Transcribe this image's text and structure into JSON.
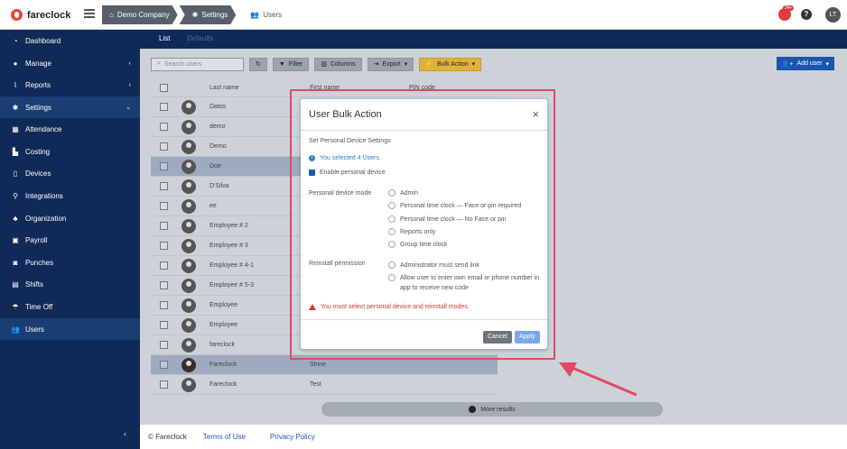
{
  "app": {
    "name": "fareclock"
  },
  "breadcrumb": [
    "Demo Company",
    "Settings",
    "Users"
  ],
  "header": {
    "notif_count": "34+",
    "help": "?",
    "user_initials": "LT"
  },
  "sidebar": {
    "items": [
      {
        "label": "Dashboard",
        "icon": "dashboard-icon"
      },
      {
        "label": "Manage",
        "icon": "user-icon",
        "chevron": "‹"
      },
      {
        "label": "Reports",
        "icon": "chart-icon",
        "chevron": "‹"
      },
      {
        "label": "Settings",
        "icon": "gear-icon",
        "chevron": "⌄",
        "active": true
      },
      {
        "label": "Attendance",
        "icon": "attendance-icon"
      },
      {
        "label": "Costing",
        "icon": "costing-icon"
      },
      {
        "label": "Devices",
        "icon": "device-icon"
      },
      {
        "label": "Integrations",
        "icon": "plug-icon"
      },
      {
        "label": "Organization",
        "icon": "org-icon"
      },
      {
        "label": "Payroll",
        "icon": "payroll-icon"
      },
      {
        "label": "Punches",
        "icon": "punch-icon"
      },
      {
        "label": "Shifts",
        "icon": "calendar-icon"
      },
      {
        "label": "Time Off",
        "icon": "beach-icon"
      },
      {
        "label": "Users",
        "icon": "users-icon",
        "active": true
      }
    ],
    "collapse": "‹"
  },
  "tabs": {
    "list": "List",
    "defaults": "Defaults"
  },
  "toolbar": {
    "search_placeholder": "Search users",
    "filter": "Filter",
    "columns": "Columns",
    "export": "Export",
    "bulk_action": "Bulk Action",
    "add_user": "Add user"
  },
  "table": {
    "headers": {
      "last_name": "Last name",
      "first_name": "First name",
      "pin": "PIN code"
    },
    "rows": [
      {
        "last_name": "Datos",
        "first_name": "",
        "selected": false
      },
      {
        "last_name": "demo",
        "first_name": "",
        "selected": false
      },
      {
        "last_name": "Demo",
        "first_name": "",
        "selected": false
      },
      {
        "last_name": "Doe",
        "first_name": "",
        "selected": true
      },
      {
        "last_name": "D'Silva",
        "first_name": "",
        "selected": false
      },
      {
        "last_name": "ee",
        "first_name": "",
        "selected": false
      },
      {
        "last_name": "Employee # 2",
        "first_name": "",
        "selected": false
      },
      {
        "last_name": "Employee # 3",
        "first_name": "",
        "selected": false
      },
      {
        "last_name": "Employee # 4-1",
        "first_name": "",
        "selected": false
      },
      {
        "last_name": "Employee # 5-3",
        "first_name": "",
        "selected": false
      },
      {
        "last_name": "Employee",
        "first_name": "",
        "selected": false
      },
      {
        "last_name": "Employee",
        "first_name": "",
        "selected": false
      },
      {
        "last_name": "fareclock",
        "first_name": "",
        "selected": false
      },
      {
        "last_name": "Fareclock",
        "first_name": "Shine",
        "selected": true
      },
      {
        "last_name": "Fareclock",
        "first_name": "Test",
        "selected": false
      }
    ]
  },
  "more_results": "More results",
  "footer": {
    "copyright": "© Fareclock",
    "terms": "Terms of Use",
    "privacy": "Privacy Policy"
  },
  "modal": {
    "title": "User Bulk Action",
    "close": "×",
    "section": "Set Personal Device Settings",
    "info": "You selected 4 Users.",
    "enable_label": "Enable personal device",
    "mode_label": "Personal device mode",
    "mode_options": [
      "Admin",
      "Personal time clock — Face or pin required",
      "Personal time clock — No Face or pin",
      "Reports only",
      "Group time clock"
    ],
    "reinstall_label": "Reinstall permission",
    "reinstall_options": [
      "Administrator must send link",
      "Allow user to enter own email or phone number in app to receive new code"
    ],
    "error": "You must select personal device and reinstall modes.",
    "cancel": "Cancel",
    "apply": "Apply"
  },
  "colors": {
    "sidebar": "#0f2a56",
    "accent": "#1a56b0",
    "warning": "#e0b23a",
    "error": "#d23a2f",
    "highlight": "#e14b63"
  }
}
